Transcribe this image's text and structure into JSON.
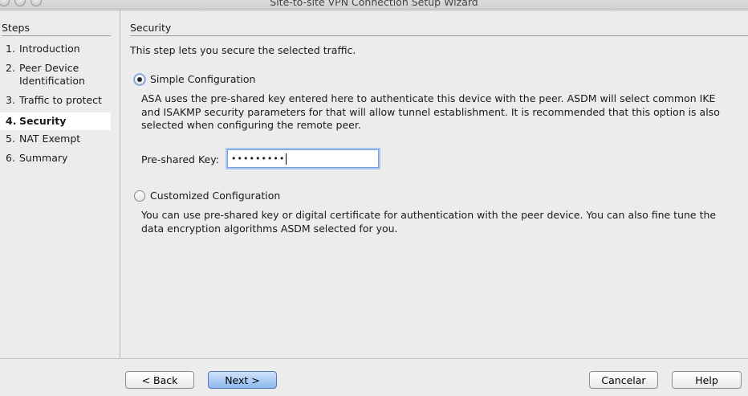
{
  "window": {
    "title": "Site-to-site VPN Connection Setup Wizard"
  },
  "steps": {
    "heading": "Steps",
    "items": [
      {
        "num": "1.",
        "label": "Introduction",
        "active": false
      },
      {
        "num": "2.",
        "label": "Peer Device Identification",
        "active": false
      },
      {
        "num": "3.",
        "label": "Traffic to protect",
        "active": false
      },
      {
        "num": "4.",
        "label": "Security",
        "active": true
      },
      {
        "num": "5.",
        "label": "NAT Exempt",
        "active": false
      },
      {
        "num": "6.",
        "label": "Summary",
        "active": false
      }
    ]
  },
  "main": {
    "heading": "Security",
    "intro": "This step lets you secure the selected traffic.",
    "simple": {
      "label": "Simple Configuration",
      "selected": true,
      "description": "ASA uses the pre-shared key entered here to authenticate this device with the peer. ASDM will select common IKE and ISAKMP security parameters for that will allow tunnel establishment. It is recommended that this option is also selected when configuring the remote peer.",
      "psk_label": "Pre-shared Key:",
      "psk_value": "•••••••••"
    },
    "custom": {
      "label": "Customized Configuration",
      "selected": false,
      "description": "You can use pre-shared key or digital certificate for authentication with the peer device. You can also fine tune the data encryption algorithms ASDM selected for you."
    }
  },
  "buttons": {
    "back": "< Back",
    "next": "Next >",
    "cancel": "Cancelar",
    "help": "Help"
  }
}
